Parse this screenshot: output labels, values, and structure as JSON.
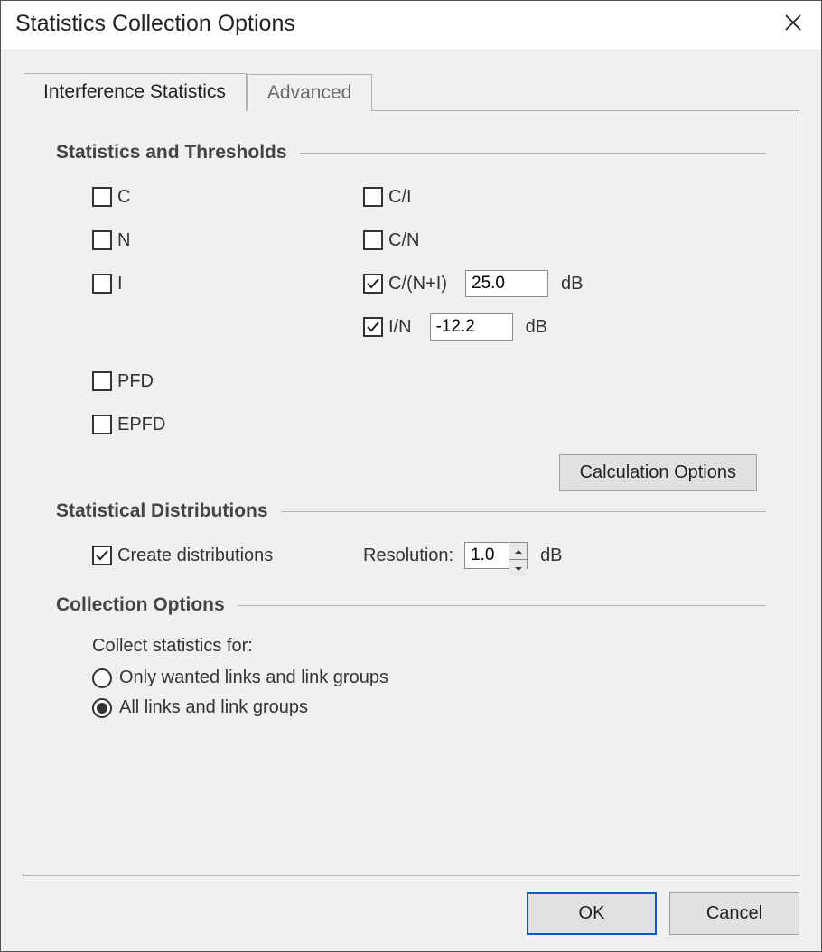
{
  "title": "Statistics Collection Options",
  "tabs": {
    "interference": "Interference Statistics",
    "advanced": "Advanced",
    "active": "interference"
  },
  "sections": {
    "stats_thresholds": "Statistics and Thresholds",
    "stat_dist": "Statistical Distributions",
    "coll_opts": "Collection Options"
  },
  "stats": {
    "c": {
      "label": "C",
      "checked": false
    },
    "n": {
      "label": "N",
      "checked": false
    },
    "i": {
      "label": "I",
      "checked": false
    },
    "ci": {
      "label": "C/I",
      "checked": false
    },
    "cn": {
      "label": "C/N",
      "checked": false
    },
    "cni": {
      "label": "C/(N+I)",
      "checked": true,
      "value": "25.0",
      "unit": "dB"
    },
    "in": {
      "label": "I/N",
      "checked": true,
      "value": "-12.2",
      "unit": "dB"
    },
    "pfd": {
      "label": "PFD",
      "checked": false
    },
    "epfd": {
      "label": "EPFD",
      "checked": false
    }
  },
  "buttons": {
    "calc_options": "Calculation Options",
    "ok": "OK",
    "cancel": "Cancel"
  },
  "distributions": {
    "create_label": "Create distributions",
    "create_checked": true,
    "resolution_label": "Resolution:",
    "resolution_value": "1.0",
    "resolution_unit": "dB"
  },
  "collection": {
    "subtitle": "Collect statistics for:",
    "opt_wanted": "Only wanted links and link groups",
    "opt_all": "All links and link groups",
    "selected": "all"
  }
}
